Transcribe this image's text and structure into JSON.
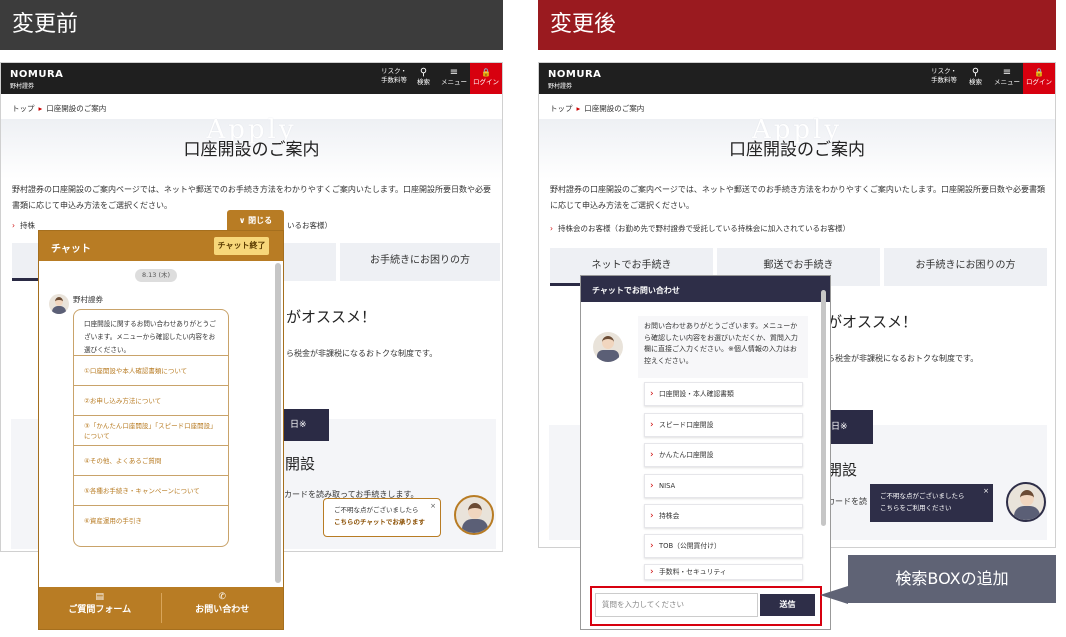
{
  "labels": {
    "before": "変更前",
    "after": "変更後"
  },
  "site": {
    "logo": "NOMURA",
    "logo_sub": "野村證券",
    "nav": [
      {
        "icon": "",
        "label1": "リスク・",
        "label2": "手数料等"
      },
      {
        "icon": "⚲",
        "label1": "",
        "label2": "検索"
      },
      {
        "icon": "≡",
        "label1": "",
        "label2": "メニュー"
      }
    ],
    "login_icon": "🔒",
    "login_label": "ログイン",
    "breadcrumb_home": "トップ",
    "breadcrumb_current": "口座開設のご案内",
    "hero_bg_text": "Apply",
    "page_title": "口座開設のご案内",
    "intro": "野村證券の口座開設のご案内ページでは、ネットや郵送でのお手続き方法をわかりやすくご案内いたします。口座開設所要日数や必要書類に応じて申込み方法をご選択ください。",
    "holder_left": "持株",
    "holder_left_tail": "いるお客様）",
    "holder_right": "持株会のお客様（お勤め先で野村證券で受託している持株会に加入されているお客様）",
    "tabs": [
      "ネットでお手続き",
      "郵送でお手続き",
      "お手続きにお困りの方"
    ],
    "recommend_tail": "がオススメ！",
    "tax_text": "ら税金が非課税になるおトクな制度です。",
    "navy_tail": "日※",
    "open_tail": "開設",
    "card_text_left": "カードを読み取ってお手続きします。",
    "card_text_right": "カードを読"
  },
  "chat_before": {
    "title": "チャット",
    "end_button": "チャット終了",
    "close_tab": "∨ 閉じる",
    "date": "8.13 (木)",
    "bot_name": "野村證券",
    "message": "口座開設に関するお問い合わせありがとうございます。メニューから確認したい内容をお選びください。",
    "options": [
      "①口座開設や本人確認書類について",
      "②お申し込み方法について",
      "③「かんたん口座開設」「スピード口座開設」について",
      "④その他、よくあるご質問",
      "⑤各種お手続き・キャンペーンについて",
      "⑥資産運用の手引き"
    ],
    "footer_left": "ご質問フォーム",
    "footer_right": "お問い合わせ",
    "tooltip_line1": "ご不明な点がございましたら",
    "tooltip_line2": "こちらのチャットでお承ります"
  },
  "chat_after": {
    "title": "チャットでお問い合わせ",
    "message": "お問い合わせありがとうございます。メニューから確認したい内容をお選びいただくか、質問入力欄に直接ご入力ください。※個人情報の入力はお控えください。",
    "options": [
      "口座開設・本人確認書類",
      "スピード口座開設",
      "かんたん口座開設",
      "NISA",
      "持株会",
      "TOB（公開買付け）",
      "手数料・セキュリティ"
    ],
    "input_placeholder": "質問を入力してください",
    "send_button": "送信",
    "tooltip_line1": "ご不明な点がございましたら",
    "tooltip_line2": "こちらをご利用ください"
  },
  "callout": "検索BOXの追加",
  "colors": {
    "before_accent": "#b87c24",
    "after_accent": "#2e2e48",
    "header_before": "#3c3c3c",
    "header_after": "#9a1a1f"
  }
}
